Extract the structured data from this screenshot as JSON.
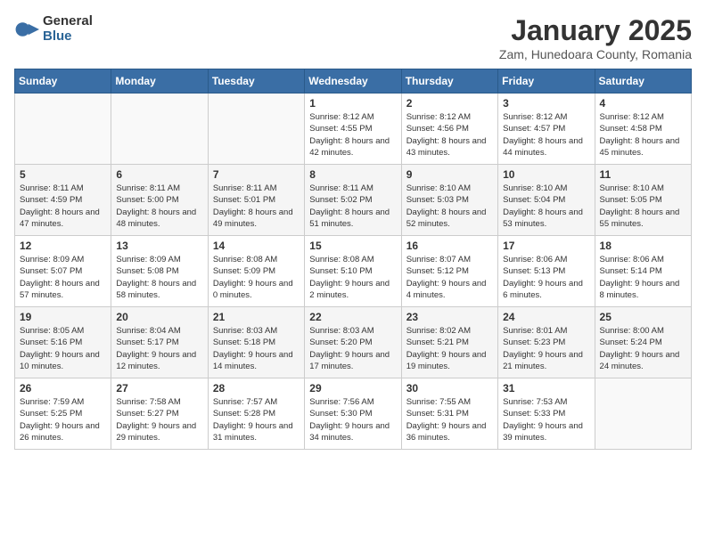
{
  "logo": {
    "general": "General",
    "blue": "Blue"
  },
  "title": "January 2025",
  "subtitle": "Zam, Hunedoara County, Romania",
  "weekdays": [
    "Sunday",
    "Monday",
    "Tuesday",
    "Wednesday",
    "Thursday",
    "Friday",
    "Saturday"
  ],
  "weeks": [
    [
      {
        "day": "",
        "info": ""
      },
      {
        "day": "",
        "info": ""
      },
      {
        "day": "",
        "info": ""
      },
      {
        "day": "1",
        "info": "Sunrise: 8:12 AM\nSunset: 4:55 PM\nDaylight: 8 hours and 42 minutes."
      },
      {
        "day": "2",
        "info": "Sunrise: 8:12 AM\nSunset: 4:56 PM\nDaylight: 8 hours and 43 minutes."
      },
      {
        "day": "3",
        "info": "Sunrise: 8:12 AM\nSunset: 4:57 PM\nDaylight: 8 hours and 44 minutes."
      },
      {
        "day": "4",
        "info": "Sunrise: 8:12 AM\nSunset: 4:58 PM\nDaylight: 8 hours and 45 minutes."
      }
    ],
    [
      {
        "day": "5",
        "info": "Sunrise: 8:11 AM\nSunset: 4:59 PM\nDaylight: 8 hours and 47 minutes."
      },
      {
        "day": "6",
        "info": "Sunrise: 8:11 AM\nSunset: 5:00 PM\nDaylight: 8 hours and 48 minutes."
      },
      {
        "day": "7",
        "info": "Sunrise: 8:11 AM\nSunset: 5:01 PM\nDaylight: 8 hours and 49 minutes."
      },
      {
        "day": "8",
        "info": "Sunrise: 8:11 AM\nSunset: 5:02 PM\nDaylight: 8 hours and 51 minutes."
      },
      {
        "day": "9",
        "info": "Sunrise: 8:10 AM\nSunset: 5:03 PM\nDaylight: 8 hours and 52 minutes."
      },
      {
        "day": "10",
        "info": "Sunrise: 8:10 AM\nSunset: 5:04 PM\nDaylight: 8 hours and 53 minutes."
      },
      {
        "day": "11",
        "info": "Sunrise: 8:10 AM\nSunset: 5:05 PM\nDaylight: 8 hours and 55 minutes."
      }
    ],
    [
      {
        "day": "12",
        "info": "Sunrise: 8:09 AM\nSunset: 5:07 PM\nDaylight: 8 hours and 57 minutes."
      },
      {
        "day": "13",
        "info": "Sunrise: 8:09 AM\nSunset: 5:08 PM\nDaylight: 8 hours and 58 minutes."
      },
      {
        "day": "14",
        "info": "Sunrise: 8:08 AM\nSunset: 5:09 PM\nDaylight: 9 hours and 0 minutes."
      },
      {
        "day": "15",
        "info": "Sunrise: 8:08 AM\nSunset: 5:10 PM\nDaylight: 9 hours and 2 minutes."
      },
      {
        "day": "16",
        "info": "Sunrise: 8:07 AM\nSunset: 5:12 PM\nDaylight: 9 hours and 4 minutes."
      },
      {
        "day": "17",
        "info": "Sunrise: 8:06 AM\nSunset: 5:13 PM\nDaylight: 9 hours and 6 minutes."
      },
      {
        "day": "18",
        "info": "Sunrise: 8:06 AM\nSunset: 5:14 PM\nDaylight: 9 hours and 8 minutes."
      }
    ],
    [
      {
        "day": "19",
        "info": "Sunrise: 8:05 AM\nSunset: 5:16 PM\nDaylight: 9 hours and 10 minutes."
      },
      {
        "day": "20",
        "info": "Sunrise: 8:04 AM\nSunset: 5:17 PM\nDaylight: 9 hours and 12 minutes."
      },
      {
        "day": "21",
        "info": "Sunrise: 8:03 AM\nSunset: 5:18 PM\nDaylight: 9 hours and 14 minutes."
      },
      {
        "day": "22",
        "info": "Sunrise: 8:03 AM\nSunset: 5:20 PM\nDaylight: 9 hours and 17 minutes."
      },
      {
        "day": "23",
        "info": "Sunrise: 8:02 AM\nSunset: 5:21 PM\nDaylight: 9 hours and 19 minutes."
      },
      {
        "day": "24",
        "info": "Sunrise: 8:01 AM\nSunset: 5:23 PM\nDaylight: 9 hours and 21 minutes."
      },
      {
        "day": "25",
        "info": "Sunrise: 8:00 AM\nSunset: 5:24 PM\nDaylight: 9 hours and 24 minutes."
      }
    ],
    [
      {
        "day": "26",
        "info": "Sunrise: 7:59 AM\nSunset: 5:25 PM\nDaylight: 9 hours and 26 minutes."
      },
      {
        "day": "27",
        "info": "Sunrise: 7:58 AM\nSunset: 5:27 PM\nDaylight: 9 hours and 29 minutes."
      },
      {
        "day": "28",
        "info": "Sunrise: 7:57 AM\nSunset: 5:28 PM\nDaylight: 9 hours and 31 minutes."
      },
      {
        "day": "29",
        "info": "Sunrise: 7:56 AM\nSunset: 5:30 PM\nDaylight: 9 hours and 34 minutes."
      },
      {
        "day": "30",
        "info": "Sunrise: 7:55 AM\nSunset: 5:31 PM\nDaylight: 9 hours and 36 minutes."
      },
      {
        "day": "31",
        "info": "Sunrise: 7:53 AM\nSunset: 5:33 PM\nDaylight: 9 hours and 39 minutes."
      },
      {
        "day": "",
        "info": ""
      }
    ]
  ]
}
